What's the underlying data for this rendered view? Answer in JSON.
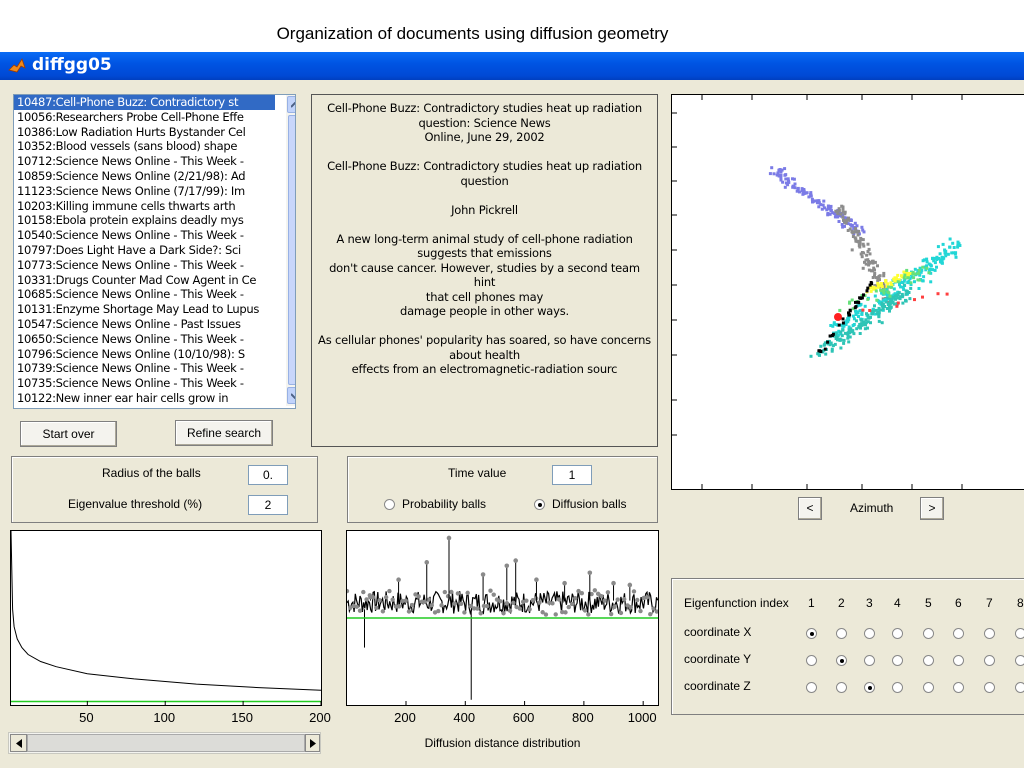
{
  "slide": {
    "title": "Organization of documents using diffusion geometry"
  },
  "window": {
    "title": "diffgg05"
  },
  "doc_list": {
    "items": [
      "10487:Cell-Phone Buzz: Contradictory st",
      "10056:Researchers Probe Cell-Phone Effe",
      "10386:Low Radiation Hurts Bystander Cel",
      "10352:Blood vessels (sans blood) shape",
      "10712:Science News Online - This Week -",
      "10859:Science News Online (2/21/98): Ad",
      "11123:Science News Online (7/17/99): Im",
      "10203:Killing immune cells thwarts arth",
      "10158:Ebola protein explains deadly mys",
      "10540:Science News Online - This Week -",
      "10797:Does Light Have a Dark Side?: Sci",
      "10773:Science News Online - This Week -",
      "10331:Drugs Counter Mad Cow Agent in Ce",
      "10685:Science News Online - This Week -",
      "10131:Enzyme Shortage May Lead to Lupus",
      "10547:Science News Online - Past Issues",
      "10650:Science News Online - This Week -",
      "10796:Science News Online (10/10/98): S",
      "10739:Science News Online - This Week -",
      "10735:Science News Online - This Week -",
      "10122:New inner ear hair cells grow in"
    ],
    "selected_index": 0
  },
  "buttons": {
    "start_over": "Start over",
    "refine_search": "Refine search"
  },
  "doc_text": {
    "lines": [
      "Cell-Phone Buzz: Contradictory studies heat up radiation",
      "question: Science News",
      "Online, June 29, 2002",
      "",
      "Cell-Phone Buzz: Contradictory studies heat up radiation",
      "question",
      "",
      "John Pickrell",
      "",
      "A new long-term animal study of cell-phone radiation",
      "suggests that emissions",
      "don't cause cancer. However, studies by a second team hint",
      "that cell phones may",
      "damage people in other ways.",
      "",
      "As cellular phones' popularity has soared, so have concerns",
      "about health",
      "effects from an electromagnetic-radiation sourc"
    ]
  },
  "balls_panel": {
    "radius_label": "Radius of the balls",
    "radius_value": "0.",
    "eig_label": "Eigenvalue threshold (%)",
    "eig_value": "2"
  },
  "time_panel": {
    "time_label": "Time value",
    "time_value": "1",
    "prob_label": "Probability balls",
    "diff_label": "Diffusion balls",
    "selected": "Diffusion balls"
  },
  "azimuth": {
    "label": "Azimuth",
    "left": "<",
    "right": ">"
  },
  "eigen_panel": {
    "header_label": "Eigenfunction index",
    "indices": [
      "1",
      "2",
      "3",
      "4",
      "5",
      "6",
      "7",
      "8"
    ],
    "rows": [
      {
        "label": "coordinate X",
        "selected": 1
      },
      {
        "label": "coordinate Y",
        "selected": 2
      },
      {
        "label": "coordinate Z",
        "selected": 3
      }
    ]
  },
  "eigen_plot": {
    "type": "line",
    "x_ticks": [
      "50",
      "100",
      "150",
      "200"
    ],
    "xlim": [
      1,
      200
    ],
    "ylim": [
      0,
      1
    ],
    "threshold": 0.02,
    "curve": [
      [
        1,
        1.0
      ],
      [
        2,
        0.55
      ],
      [
        3,
        0.45
      ],
      [
        5,
        0.38
      ],
      [
        8,
        0.33
      ],
      [
        12,
        0.29
      ],
      [
        20,
        0.25
      ],
      [
        30,
        0.22
      ],
      [
        50,
        0.18
      ],
      [
        80,
        0.15
      ],
      [
        120,
        0.12
      ],
      [
        160,
        0.1
      ],
      [
        200,
        0.085
      ]
    ]
  },
  "diffusion_plot": {
    "type": "line",
    "xlabel": "Diffusion distance distribution",
    "x_ticks": [
      "200",
      "400",
      "600",
      "800",
      "1000"
    ],
    "xlim": [
      1,
      1050
    ],
    "ylim": [
      0,
      1
    ],
    "baseline": 0.5,
    "spikes_up": [
      [
        80,
        0.62
      ],
      [
        175,
        0.72
      ],
      [
        270,
        0.82
      ],
      [
        345,
        0.96
      ],
      [
        460,
        0.75
      ],
      [
        540,
        0.8
      ],
      [
        570,
        0.83
      ],
      [
        640,
        0.72
      ],
      [
        735,
        0.7
      ],
      [
        820,
        0.76
      ],
      [
        900,
        0.7
      ],
      [
        955,
        0.69
      ]
    ],
    "spikes_down": [
      [
        420,
        0.03
      ],
      [
        60,
        0.33
      ]
    ]
  },
  "scatter_plot": {
    "type": "scatter",
    "clusters": [
      {
        "color": "#7b7be6",
        "count": 120
      },
      {
        "color": "#8c8c8c",
        "count": 110
      },
      {
        "color": "#22d6d6",
        "count": 200
      },
      {
        "color": "#2ec4b6",
        "count": 150
      },
      {
        "color": "#ffff33",
        "count": 40
      },
      {
        "color": "#66e07a",
        "count": 40
      },
      {
        "color": "#000000",
        "count": 30
      },
      {
        "color": "#ff4040",
        "count": 8
      }
    ]
  }
}
